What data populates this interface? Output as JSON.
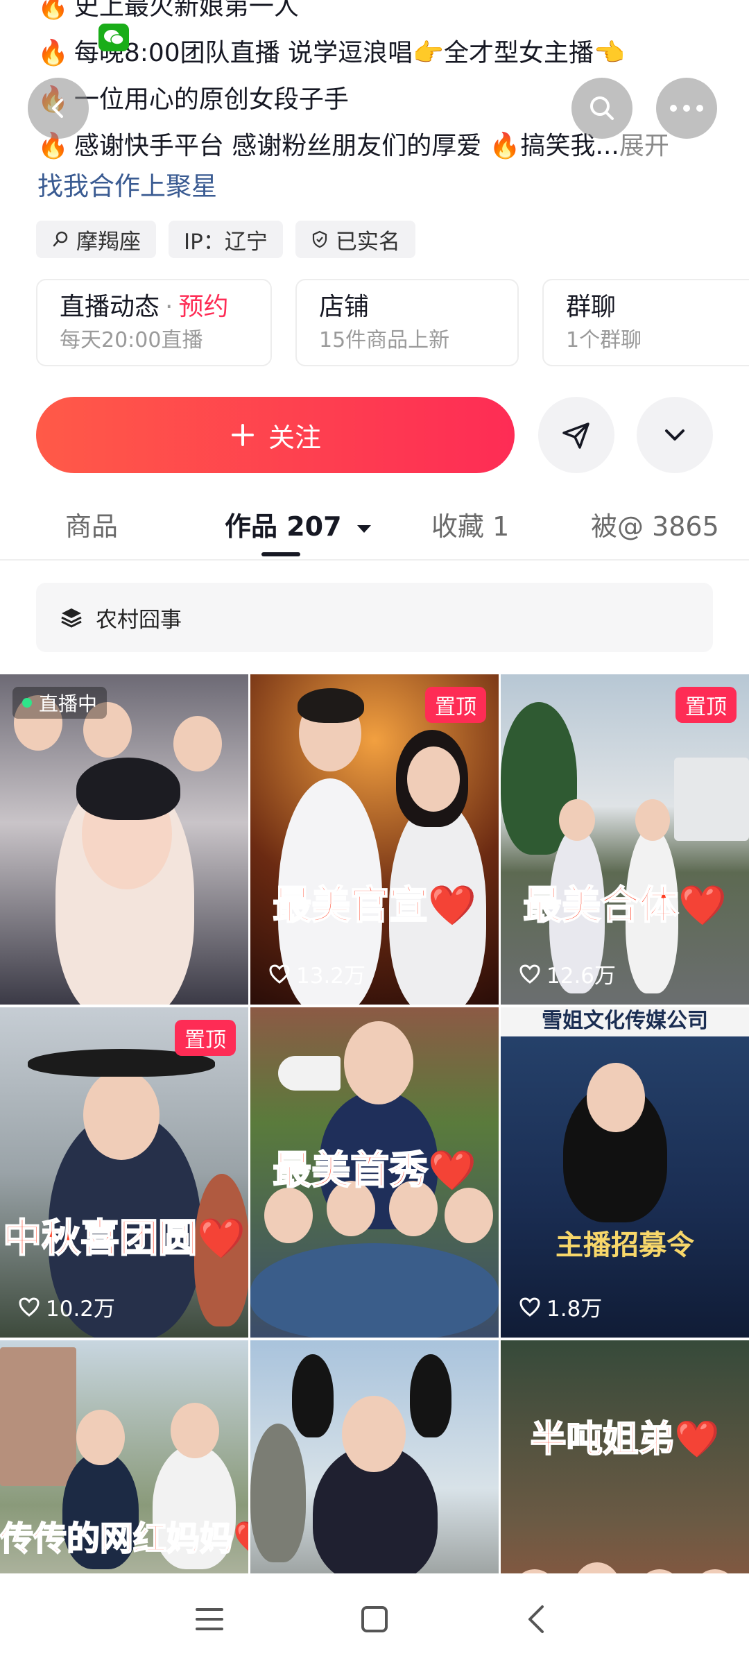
{
  "bio": {
    "lines": [
      {
        "icon": "🔥",
        "text": "史上最火新娘第一人"
      },
      {
        "icon": "🔥",
        "text": "每晚8:00团队直播 说学逗浪唱👉全才型女主播👈"
      },
      {
        "icon": "🔥",
        "text": "一位用心的原创女段子手"
      },
      {
        "icon": "🔥",
        "text": "感谢快手平台 感谢粉丝朋友们的厚爱 🔥搞笑我..."
      }
    ],
    "expand": "展开",
    "collab": "找我合作上聚星"
  },
  "tags": [
    {
      "icon": "constellation-icon",
      "label": "摩羯座"
    },
    {
      "icon": "",
      "label": "IP：辽宁"
    },
    {
      "icon": "verified-shield-icon",
      "label": "已实名"
    }
  ],
  "cards": {
    "live": {
      "title": "直播动态",
      "sep": "·",
      "action": "预约",
      "subtitle": "每天20:00直播"
    },
    "shop": {
      "title": "店铺",
      "subtitle": "15件商品上新"
    },
    "group": {
      "title": "群聊",
      "subtitle": "1个群聊"
    }
  },
  "follow": {
    "label": "关注",
    "accent": "#fe2c55"
  },
  "tabs": {
    "goods": "商品",
    "works": "作品 207",
    "favorites": "收藏 1",
    "mentions": "被@ 3865"
  },
  "collection": {
    "label": "农村囧事"
  },
  "videos": [
    {
      "live_label": "直播中",
      "pinned": "",
      "caption": "",
      "likes": ""
    },
    {
      "live_label": "",
      "pinned": "置顶",
      "caption": "最美官宣❤️",
      "likes": "13.2万"
    },
    {
      "live_label": "",
      "pinned": "置顶",
      "caption": "最美合体❤️",
      "likes": "12.6万"
    },
    {
      "live_label": "",
      "pinned": "置顶",
      "caption": "中秋喜团圆❤️",
      "likes": "10.2万"
    },
    {
      "live_label": "",
      "pinned": "",
      "caption": "最美首秀❤️",
      "likes": ""
    },
    {
      "live_label": "",
      "pinned": "",
      "caption": "",
      "likes": "1.8万",
      "header": "雪姐文化传媒公司",
      "promo": "主播招募令"
    },
    {
      "live_label": "",
      "pinned": "",
      "caption": "传传的网红妈妈❤️",
      "likes": ""
    },
    {
      "live_label": "",
      "pinned": "",
      "caption": "",
      "likes": ""
    },
    {
      "live_label": "",
      "pinned": "",
      "caption": "半吨姐弟❤️",
      "likes": ""
    }
  ]
}
